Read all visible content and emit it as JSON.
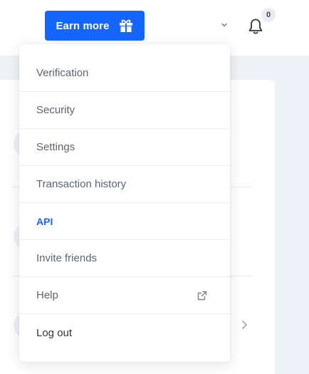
{
  "header": {
    "earn_button": {
      "label": "Earn more",
      "icon": "gift-icon"
    },
    "account_dropdown": {
      "icon": "chevron-down-icon"
    },
    "notifications": {
      "icon": "bell-icon",
      "count": "0"
    }
  },
  "menu": {
    "items": [
      {
        "label": "Verification"
      },
      {
        "label": "Security"
      },
      {
        "label": "Settings"
      },
      {
        "label": "Transaction history"
      },
      {
        "label": "API",
        "active": true
      },
      {
        "label": "Invite friends"
      },
      {
        "label": "Help",
        "icon": "external-link-icon"
      },
      {
        "label": "Log out"
      }
    ]
  },
  "colors": {
    "accent": "#1466ff",
    "menu_text": "#5c6573",
    "page_background": "#eef1f5"
  }
}
